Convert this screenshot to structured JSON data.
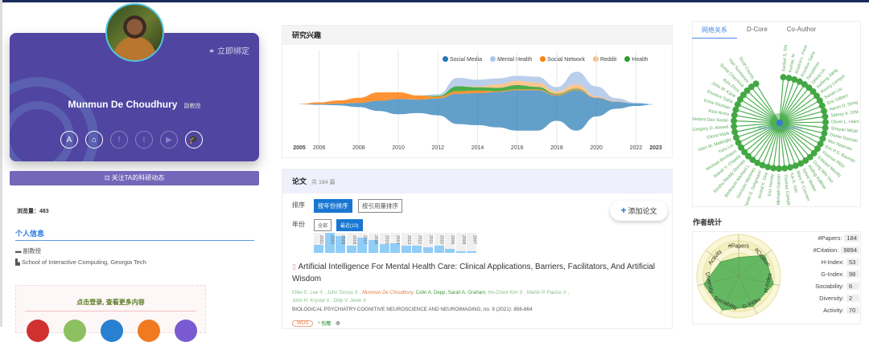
{
  "profile": {
    "name": "Munmun De Choudhury",
    "title": "副教授",
    "bind_label": "立即绑定",
    "follow_label": "关注TA的科研动态",
    "views_label": "浏览量：",
    "views": "483",
    "section_title": "个人信息",
    "position": "副教授",
    "affiliation": "School of Interactive Computing, Georgia Tech",
    "login_prompt": "点击登录, 查看更多内容",
    "social_icons": [
      "aminer-icon",
      "home-icon",
      "facebook-icon",
      "twitter-icon",
      "youtube-icon",
      "scholar-icon"
    ]
  },
  "interests": {
    "title": "研究兴趣"
  },
  "chart_data": {
    "type": "area",
    "subtype": "streamgraph",
    "title": "研究兴趣",
    "x": [
      2005,
      2006,
      2007,
      2008,
      2009,
      2010,
      2011,
      2012,
      2013,
      2014,
      2015,
      2016,
      2017,
      2018,
      2019,
      2020,
      2021,
      2022,
      2023
    ],
    "x_ticks": [
      "2005",
      "2006",
      "2008",
      "2010",
      "2012",
      "2014",
      "2016",
      "2018",
      "2020",
      "2022",
      "2023"
    ],
    "legend_position": "top-right",
    "series": [
      {
        "name": "Social Media",
        "color": "#1f77b4",
        "values": [
          0,
          1,
          2,
          5,
          12,
          18,
          16,
          20,
          36,
          38,
          42,
          48,
          48,
          30,
          48,
          22,
          8,
          3,
          0
        ]
      },
      {
        "name": "Social Network",
        "color": "#ff7f0e",
        "values": [
          0.5,
          2,
          4,
          6,
          10,
          8,
          5,
          2,
          3,
          3,
          1,
          1,
          1,
          1,
          1,
          0.5,
          0.5,
          0,
          0
        ]
      },
      {
        "name": "Health",
        "color": "#2ca02c",
        "values": [
          0,
          0,
          0,
          0,
          0,
          0,
          0,
          1,
          6,
          4,
          4,
          5,
          3,
          1,
          1,
          0,
          0,
          0,
          0
        ]
      },
      {
        "name": "Reddit",
        "color": "#ffbb78",
        "values": [
          0,
          0,
          0,
          0,
          0,
          0,
          0,
          0,
          0,
          1,
          4,
          5,
          5,
          3,
          5,
          1,
          0,
          0,
          0
        ]
      },
      {
        "name": "Mental Health",
        "color": "#aec7e8",
        "values": [
          0,
          0,
          0,
          0,
          0,
          0,
          0,
          2,
          10,
          8,
          7,
          6,
          7,
          5,
          15,
          12,
          4,
          1,
          0
        ]
      }
    ]
  },
  "papers": {
    "title": "论文",
    "count_label": "共 184 篇",
    "sort_label": "排序",
    "sort_by_year": "按年份排序",
    "sort_by_citation": "按引用量排序",
    "year_label": "年份",
    "all": "全部",
    "recent": "最近(10)",
    "add_label": "添加论文",
    "year_bars": [
      {
        "y": "2021",
        "v": 0.4
      },
      {
        "y": "2020",
        "v": 1.0
      },
      {
        "y": "2019",
        "v": 0.85
      },
      {
        "y": "2018",
        "v": 0.35
      },
      {
        "y": "2017",
        "v": 0.75
      },
      {
        "y": "2016",
        "v": 0.65
      },
      {
        "y": "2015",
        "v": 0.45
      },
      {
        "y": "2014",
        "v": 0.5
      },
      {
        "y": "2013",
        "v": 0.35
      },
      {
        "y": "2012",
        "v": 0.35
      },
      {
        "y": "2011",
        "v": 0.3
      },
      {
        "y": "2010",
        "v": 0.35
      },
      {
        "y": "2009",
        "v": 0.2
      },
      {
        "y": "2008",
        "v": 0.1
      },
      {
        "y": "2007",
        "v": 0.08
      }
    ],
    "first": {
      "title": "Artificial Intelligence For Mental Health Care: Clinical Applications, Barriers, Facilitators, And Artificial Wisdom",
      "a1": "Ellen E. Lee",
      "a2": "John Torous",
      "a3": "Munmun De Choudhury,",
      "a4": "Colin A. Depp,",
      "a5": "Sarah A. Graham,",
      "a6": "Ho-Cheol Kim",
      "a7": "Martin P. Paulus",
      "a8": "John H. Krystal",
      "a9": "Dilip V. Jeste",
      "venue": "BIOLOGICAL PSYCHIATRY-COGNITIVE NEUROSCIENCE AND NEUROIMAGING, no. 9 (2021): 856-864",
      "tag": "WOS",
      "cite": "引用"
    }
  },
  "network": {
    "tabs": [
      "网络关系",
      "D-Core",
      "Co-Author"
    ],
    "center": "Munmun De Choudhury",
    "nodes": [
      "Sankat S. Shi",
      "Kumar, M.",
      "Jessica L. Feus",
      "Koustuv Saha",
      "Tanushree",
      "Dhiraj Lin",
      "Keifeng Jiang",
      "Ronny Lempel",
      "Susan Liu",
      "Eric Gilbert",
      "Aaron D. Streg",
      "Sidney K. D'M",
      "Oliver L. Haim",
      "Shayan Mirjal",
      "Dorée Duncan",
      "Mor Naaman",
      "Eric P.S. Baumer",
      "Thomas Plötz",
      "Edward Moody",
      "Dong Whi Yoo",
      "Aisling Kelliher",
      "Sylvie Weber",
      "Mary P. Czerwin",
      "Kai A. Nits",
      "Thomas Campbell",
      "Michael Gamon",
      "Eric Horvitz",
      "Arvind K. Dey",
      "Daniel D. Seligmann",
      "Gonzalo Martinez",
      "Birnbaum Michael L.",
      "Sindhu Reddy Domala",
      "Nitesh V. Chawla",
      "Michael Birnbaum",
      "Yuru Lin",
      "Glen M. Mattingly",
      "Gloria Mark",
      "Gregory D. Abowd",
      "Vedant Das Swain",
      "Ravi Arora",
      "Emre Kiciman",
      "Koustuv Saha",
      "John M. Kane",
      "Ayla Zhou",
      "Sonia Chernova",
      "Hari Sundaram",
      "Scott Counts"
    ]
  },
  "author_stats": {
    "title": "作者统计",
    "axes": [
      "#Papers",
      "#Citation",
      "H-Index",
      "G-Index",
      "Sociability",
      "Diversity",
      "Activity"
    ],
    "radar_levels": [
      0.45,
      0.8,
      0.85,
      0.8,
      0.9,
      0.85,
      0.55
    ],
    "rows": [
      {
        "k": "#Papers:",
        "v": "184"
      },
      {
        "k": "#Citation:",
        "v": "9894"
      },
      {
        "k": "H-Index:",
        "v": "53"
      },
      {
        "k": "G-Index:",
        "v": "98"
      },
      {
        "k": "Sociability:",
        "v": "6"
      },
      {
        "k": "Diversity:",
        "v": "2"
      },
      {
        "k": "Activity:",
        "v": "70"
      }
    ]
  }
}
